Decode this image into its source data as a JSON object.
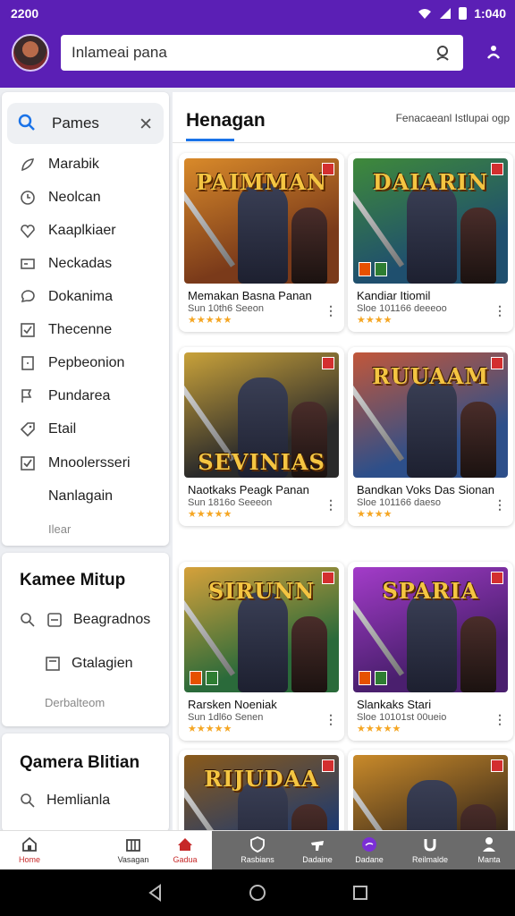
{
  "status": {
    "time": "2200",
    "clock": "1:040"
  },
  "header": {
    "search_text": "Inlameai pana"
  },
  "sidebar": {
    "search_query": "Pames",
    "items": [
      {
        "label": "Marabik",
        "icon": "feather-icon"
      },
      {
        "label": "Neolcan",
        "icon": "clock-icon"
      },
      {
        "label": "Kaaplkiaer",
        "icon": "heart-icon"
      },
      {
        "label": "Neckadas",
        "icon": "gamepad-icon"
      },
      {
        "label": "Dokanima",
        "icon": "chat-icon"
      },
      {
        "label": "Thecenne",
        "icon": "checklist-icon"
      },
      {
        "label": "Pepbeonion",
        "icon": "square-icon"
      },
      {
        "label": "Pundarea",
        "icon": "flag-icon"
      },
      {
        "label": "Etail",
        "icon": "tag-icon"
      },
      {
        "label": "Mnoolersseri",
        "icon": "checkbox-icon"
      },
      {
        "label": "Nanlagain",
        "icon": ""
      }
    ],
    "more_label": "Ilear"
  },
  "section2": {
    "title": "Kamee Mitup",
    "row1": "Beagradnos",
    "row2": "Gtalagien",
    "sub": "Derbalteom"
  },
  "section3": {
    "title": "Qamera Blitian",
    "row1": "Hemlianla"
  },
  "main": {
    "tab": "Henagan",
    "link": "Fenacaeanl Istlupai ogp",
    "cards": [
      {
        "logo": "PAIMMAN",
        "name": "Memakan Basna Panan",
        "meta": "Sun 10th6 Seeon",
        "stars": "★★★★★",
        "theme": "#7a3a1a",
        "theme2": "#d98a2a"
      },
      {
        "logo": "DAIARIN",
        "name": "Kandiar Itiomil",
        "meta": "Sloe 101166 deeeoo",
        "stars": "★★★★",
        "theme": "#1f4f6e",
        "theme2": "#3f8a3a"
      },
      {
        "logo": "SEVINIAS",
        "name": "Naotkaks Peagk Panan",
        "meta": "Sun 1816o Seeeon",
        "stars": "★★★★★",
        "theme": "#2a2a2a",
        "theme2": "#c9a23a"
      },
      {
        "logo": "RUUAAM",
        "name": "Bandkan Voks Das Sionan",
        "meta": "Sloe 101166 daeso",
        "stars": "★★★★",
        "theme": "#2d4f8a",
        "theme2": "#c2573a"
      },
      {
        "logo": "SIRUNN",
        "name": "Rarsken Noeniak",
        "meta": "Sun 1dl6o Senen",
        "stars": "★★★★★",
        "theme": "#2a6a3a",
        "theme2": "#d6a13a"
      },
      {
        "logo": "SPARIA",
        "name": "Slankaks Stari",
        "meta": "Sloe 10101st 00ueio",
        "stars": "★★★★★",
        "theme": "#4a1f6e",
        "theme2": "#a33cc9"
      },
      {
        "logo": "RIJUDAA",
        "name": "",
        "meta": "",
        "stars": "",
        "theme": "#1f3a6e",
        "theme2": "#8a5a1a"
      },
      {
        "logo": "",
        "name": "",
        "meta": "",
        "stars": "",
        "theme": "#3a2a1a",
        "theme2": "#c98a2a"
      }
    ]
  },
  "bottom_nav": [
    {
      "label": "Home",
      "icon": "home-icon"
    },
    {
      "label": "Vasagan",
      "icon": "grid-icon"
    },
    {
      "label": "Gadua",
      "icon": "house-icon"
    },
    {
      "label": "Rasbians",
      "icon": "shield-icon"
    },
    {
      "label": "Dadaine",
      "icon": "hat-icon"
    },
    {
      "label": "Dadane",
      "icon": "chat-bubble-icon"
    },
    {
      "label": "Reilmalde",
      "icon": "horseshoe-icon"
    },
    {
      "label": "Manta",
      "icon": "person-icon"
    }
  ],
  "colors": {
    "brand": "#5b1fb5",
    "accent": "#1a73e8",
    "star": "#f5a623",
    "active_nav": "#c62828"
  }
}
